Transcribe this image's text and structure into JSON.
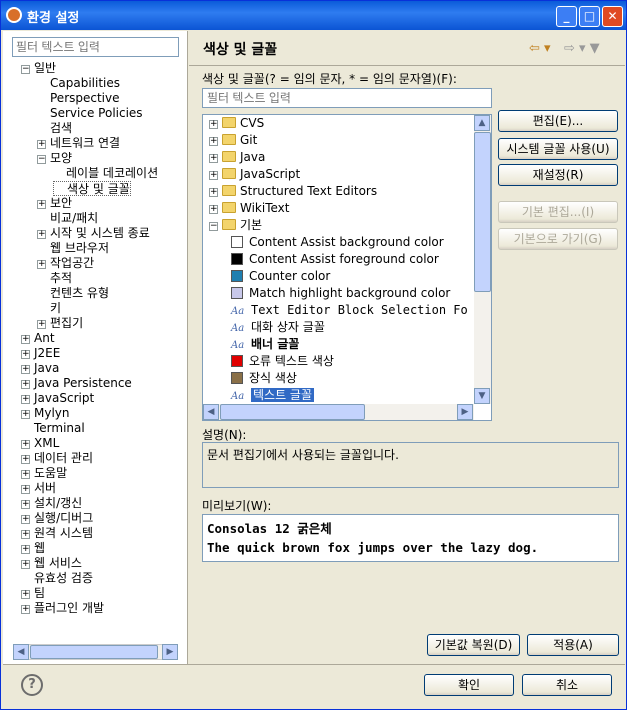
{
  "window": {
    "title": "환경 설정",
    "min": "_",
    "max": "□",
    "close": "✕"
  },
  "left": {
    "filter_placeholder": "필터 텍스트 입력",
    "tree": [
      {
        "label": "일반",
        "depth": 0,
        "exp": "−"
      },
      {
        "label": "Capabilities",
        "depth": 1,
        "exp": ""
      },
      {
        "label": "Perspective",
        "depth": 1,
        "exp": ""
      },
      {
        "label": "Service Policies",
        "depth": 1,
        "exp": ""
      },
      {
        "label": "검색",
        "depth": 1,
        "exp": ""
      },
      {
        "label": "네트워크 연결",
        "depth": 1,
        "exp": "+"
      },
      {
        "label": "모양",
        "depth": 1,
        "exp": "−"
      },
      {
        "label": "레이블 데코레이션",
        "depth": 2,
        "exp": ""
      },
      {
        "label": "색상 및 글꼴",
        "depth": 2,
        "exp": "",
        "selected": true
      },
      {
        "label": "보안",
        "depth": 1,
        "exp": "+"
      },
      {
        "label": "비교/패치",
        "depth": 1,
        "exp": ""
      },
      {
        "label": "시작 및 시스템 종료",
        "depth": 1,
        "exp": "+"
      },
      {
        "label": "웹 브라우저",
        "depth": 1,
        "exp": ""
      },
      {
        "label": "작업공간",
        "depth": 1,
        "exp": "+"
      },
      {
        "label": "추적",
        "depth": 1,
        "exp": ""
      },
      {
        "label": "컨텐츠 유형",
        "depth": 1,
        "exp": ""
      },
      {
        "label": "키",
        "depth": 1,
        "exp": ""
      },
      {
        "label": "편집기",
        "depth": 1,
        "exp": "+"
      },
      {
        "label": "Ant",
        "depth": 0,
        "exp": "+"
      },
      {
        "label": "J2EE",
        "depth": 0,
        "exp": "+"
      },
      {
        "label": "Java",
        "depth": 0,
        "exp": "+"
      },
      {
        "label": "Java Persistence",
        "depth": 0,
        "exp": "+"
      },
      {
        "label": "JavaScript",
        "depth": 0,
        "exp": "+"
      },
      {
        "label": "Mylyn",
        "depth": 0,
        "exp": "+"
      },
      {
        "label": "Terminal",
        "depth": 0,
        "exp": ""
      },
      {
        "label": "XML",
        "depth": 0,
        "exp": "+"
      },
      {
        "label": "데이터 관리",
        "depth": 0,
        "exp": "+"
      },
      {
        "label": "도움말",
        "depth": 0,
        "exp": "+"
      },
      {
        "label": "서버",
        "depth": 0,
        "exp": "+"
      },
      {
        "label": "설치/갱신",
        "depth": 0,
        "exp": "+"
      },
      {
        "label": "실행/디버그",
        "depth": 0,
        "exp": "+"
      },
      {
        "label": "원격 시스템",
        "depth": 0,
        "exp": "+"
      },
      {
        "label": "웹",
        "depth": 0,
        "exp": "+"
      },
      {
        "label": "웹 서비스",
        "depth": 0,
        "exp": "+"
      },
      {
        "label": "유효성 검증",
        "depth": 0,
        "exp": ""
      },
      {
        "label": "팀",
        "depth": 0,
        "exp": "+"
      },
      {
        "label": "플러그인 개발",
        "depth": 0,
        "exp": "+"
      }
    ]
  },
  "right": {
    "heading": "색상 및 글꼴",
    "nav_back": "⇦ ▾",
    "nav_fwd": "⇨ ▾ ▼",
    "list_label": "색상 및 글꼴(? = 임의 문자, * = 임의 문자열)(F):",
    "filter_placeholder": "필터 텍스트 입력",
    "items": [
      {
        "label": "CVS",
        "kind": "folder",
        "exp": "+"
      },
      {
        "label": "Git",
        "kind": "folder",
        "exp": "+"
      },
      {
        "label": "Java",
        "kind": "folder",
        "exp": "+"
      },
      {
        "label": "JavaScript",
        "kind": "folder",
        "exp": "+"
      },
      {
        "label": "Structured Text Editors",
        "kind": "folder",
        "exp": "+"
      },
      {
        "label": "WikiText",
        "kind": "folder",
        "exp": "+"
      },
      {
        "label": "기본",
        "kind": "folder",
        "exp": "−"
      },
      {
        "label": "Content Assist background color",
        "kind": "color",
        "color": "#ffffff"
      },
      {
        "label": "Content Assist foreground color",
        "kind": "color",
        "color": "#000000"
      },
      {
        "label": "Counter color",
        "kind": "color",
        "color": "#1f7fb0"
      },
      {
        "label": "Match highlight background color",
        "kind": "color",
        "color": "#c8c8ea"
      },
      {
        "label": "Text Editor Block Selection Fo",
        "kind": "font",
        "mono": true
      },
      {
        "label": "대화 상자 글꼴",
        "kind": "font"
      },
      {
        "label": "배너 글꼴",
        "kind": "font",
        "bold": true
      },
      {
        "label": "오류 텍스트 색상",
        "kind": "color",
        "color": "#e00000"
      },
      {
        "label": "장식 색상",
        "kind": "color",
        "color": "#8a7048"
      },
      {
        "label": "텍스트 글꼴",
        "kind": "font",
        "selected": true
      }
    ],
    "buttons": {
      "edit": "편집(E)...",
      "use_system_font": "시스템 글꼴 사용(U)",
      "reset": "재설정(R)",
      "edit_default": "기본 편집...(I)",
      "go_default": "기본으로 가기(G)"
    },
    "desc_label": "설명(N):",
    "desc_text": "문서 편집기에서 사용되는 글꼴입니다.",
    "preview_label": "미리보기(W):",
    "preview_line1": "Consolas 12 굵은체",
    "preview_line2": "The quick brown fox jumps over the lazy dog.",
    "restore_defaults": "기본값 복원(D)",
    "apply": "적용(A)"
  },
  "footer": {
    "help": "?",
    "ok": "확인",
    "cancel": "취소"
  }
}
